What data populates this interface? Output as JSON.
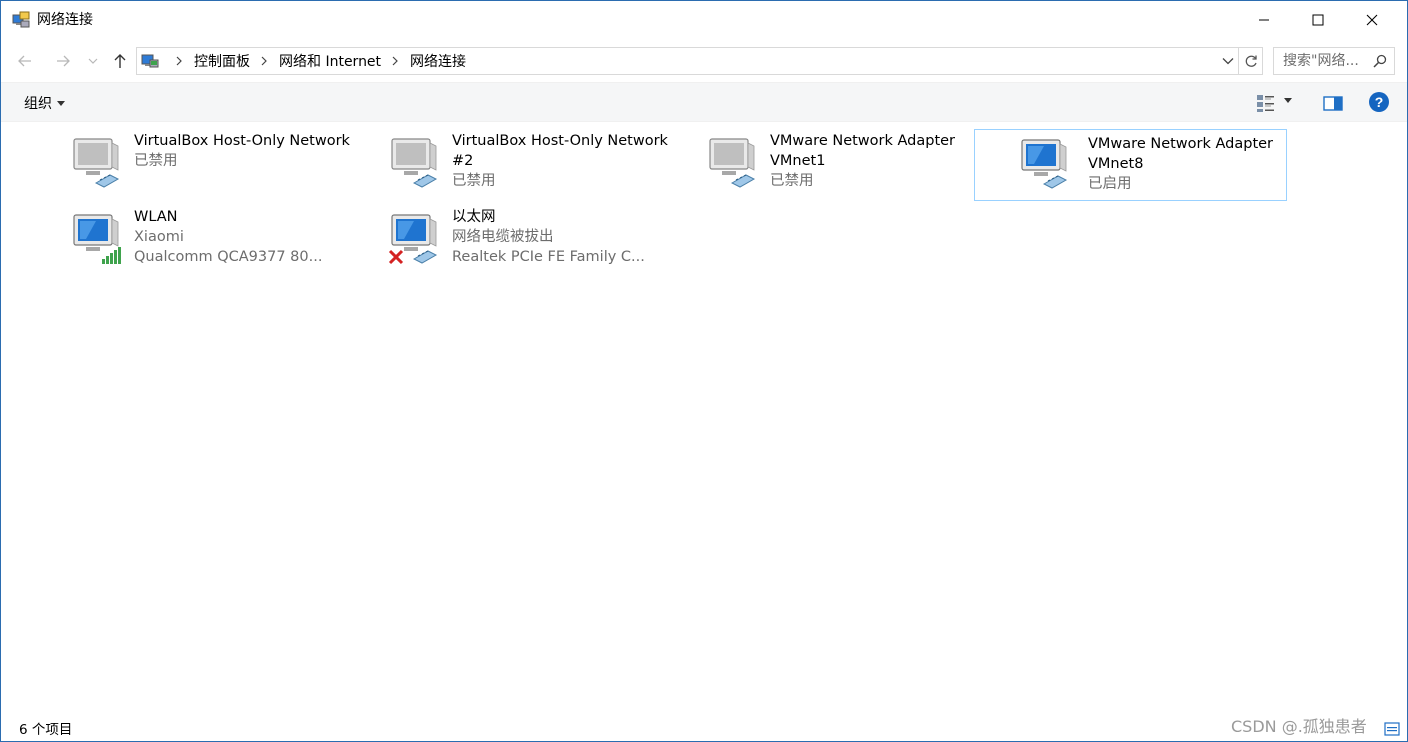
{
  "window": {
    "title": "网络连接"
  },
  "address": {
    "breadcrumbs": [
      "控制面板",
      "网络和 Internet",
      "网络连接"
    ],
    "search_placeholder": "搜索\"网络..."
  },
  "toolbar": {
    "organize_label": "组织"
  },
  "items": [
    {
      "name": "VirtualBox Host-Only Network",
      "status": "已禁用",
      "device": "",
      "icon": "network-adapter-icon",
      "state": "disabled"
    },
    {
      "name": "VirtualBox Host-Only Network #2",
      "status": "已禁用",
      "device": "",
      "icon": "network-adapter-icon",
      "state": "disabled"
    },
    {
      "name": "VMware Network Adapter VMnet1",
      "status": "已禁用",
      "device": "",
      "icon": "network-adapter-icon",
      "state": "disabled"
    },
    {
      "name": "VMware Network Adapter VMnet8",
      "status": "已启用",
      "device": "",
      "icon": "network-adapter-icon",
      "state": "enabled",
      "selected": true
    },
    {
      "name": "WLAN",
      "status": "Xiaomi",
      "device": "Qualcomm QCA9377 80...",
      "icon": "wlan-adapter-icon",
      "state": "connected"
    },
    {
      "name": "以太网",
      "status": "网络电缆被拔出",
      "device": "Realtek PCIe FE Family C...",
      "icon": "ethernet-adapter-icon",
      "state": "cable-unplugged"
    }
  ],
  "status": {
    "item_count": "6 个项目"
  },
  "watermark": "CSDN @.孤独患者",
  "colors": {
    "accent": "#1f6fc5",
    "selection_border": "#99d1ff",
    "subtext": "#6d6d6d"
  }
}
